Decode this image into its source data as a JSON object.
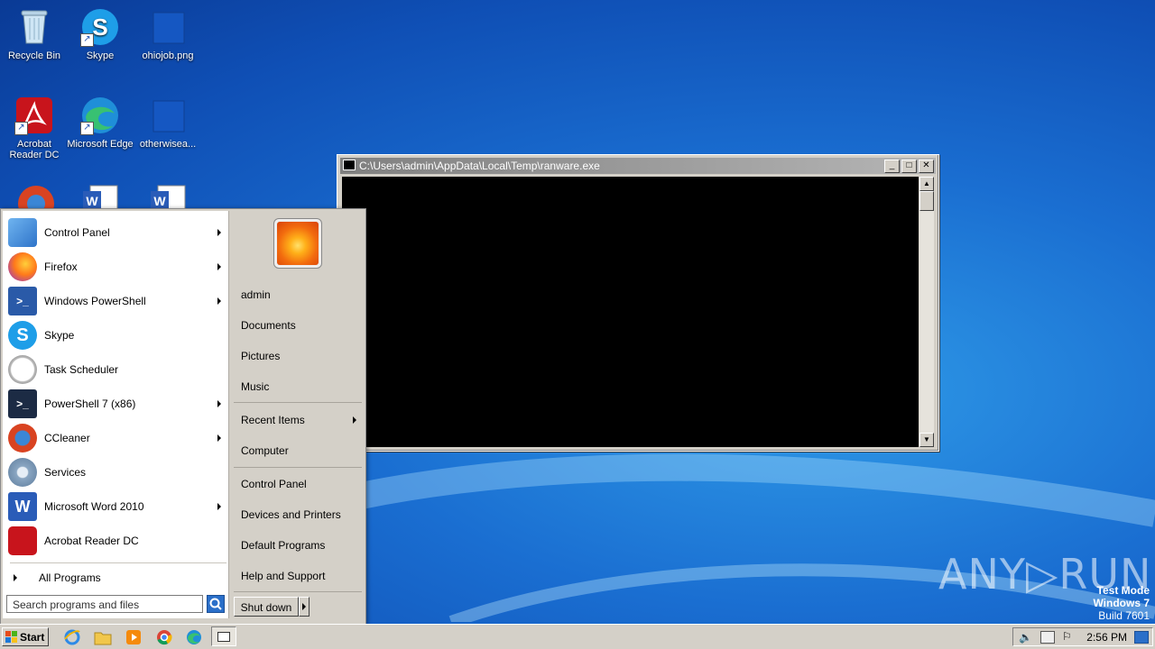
{
  "desktop": {
    "icons": [
      {
        "label": "Recycle Bin",
        "icon": "recycle-bin-icon"
      },
      {
        "label": "Skype",
        "icon": "skype-icon"
      },
      {
        "label": "ohiojob.png",
        "icon": "image-file-icon"
      },
      {
        "label": "Acrobat Reader DC",
        "icon": "acrobat-icon"
      },
      {
        "label": "Microsoft Edge",
        "icon": "edge-icon"
      },
      {
        "label": "otherwisea...",
        "icon": "file-icon"
      }
    ]
  },
  "console": {
    "title": "C:\\Users\\admin\\AppData\\Local\\Temp\\ranware.exe",
    "minimize": "_",
    "maximize": "□",
    "close": "✕"
  },
  "start_menu": {
    "programs": [
      {
        "label": "Control Panel",
        "icon": "control-panel-icon",
        "submenu": true
      },
      {
        "label": "Firefox",
        "icon": "firefox-icon",
        "submenu": true
      },
      {
        "label": "Windows PowerShell",
        "icon": "powershell-icon",
        "submenu": true
      },
      {
        "label": "Skype",
        "icon": "skype-icon",
        "submenu": false
      },
      {
        "label": "Task Scheduler",
        "icon": "clock-icon",
        "submenu": false
      },
      {
        "label": "PowerShell 7 (x86)",
        "icon": "powershell7-icon",
        "submenu": true
      },
      {
        "label": "CCleaner",
        "icon": "ccleaner-icon",
        "submenu": true
      },
      {
        "label": "Services",
        "icon": "gears-icon",
        "submenu": false
      },
      {
        "label": "Microsoft Word 2010",
        "icon": "word-icon",
        "submenu": true
      },
      {
        "label": "Acrobat Reader DC",
        "icon": "acrobat-icon",
        "submenu": false
      }
    ],
    "all_programs": "All Programs",
    "search_placeholder": "Search programs and files",
    "right": {
      "user": "admin",
      "documents": "Documents",
      "pictures": "Pictures",
      "music": "Music",
      "recent_items": "Recent Items",
      "computer": "Computer",
      "control_panel": "Control Panel",
      "devices_printers": "Devices and Printers",
      "default_programs": "Default Programs",
      "help_support": "Help and Support"
    },
    "shutdown": "Shut down"
  },
  "taskbar": {
    "start_label": "Start",
    "clock": "2:56 PM",
    "pinned": [
      "internet-explorer-icon",
      "explorer-icon",
      "media-player-icon",
      "chrome-icon",
      "edge-icon",
      "console-window-icon"
    ]
  },
  "watermark": {
    "line1": "Test Mode",
    "line2": "Windows 7",
    "line3": "Build 7601",
    "brand": "ANY▷RUN"
  },
  "colors": {
    "desktop_blue": "#1a6ed1",
    "console_bg": "#000000",
    "window_chrome": "#d4d0c8"
  }
}
